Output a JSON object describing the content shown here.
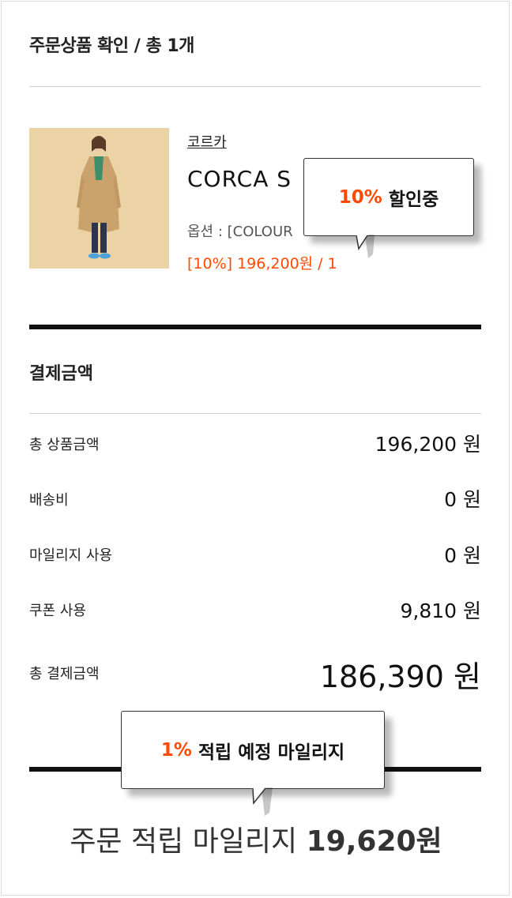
{
  "order": {
    "title": "주문상품 확인 / 총 1개"
  },
  "product": {
    "brand": "코르카",
    "name": "CORCA S",
    "option": "옵션 : [COLOUR",
    "price_line": "[10%] 196,200원 / 1",
    "discount_badge": {
      "percent": "10%",
      "text": "할인중"
    }
  },
  "payment": {
    "title": "결제금액",
    "rows": [
      {
        "label": "총 상품금액",
        "value": "196,200 원"
      },
      {
        "label": "배송비",
        "value": "0 원"
      },
      {
        "label": "마일리지 사용",
        "value": "0 원"
      },
      {
        "label": "쿠폰 사용",
        "value": "9,810 원"
      },
      {
        "label": "총 결제금액",
        "value": "186,390 원"
      }
    ]
  },
  "mileage": {
    "bubble": {
      "percent": "1%",
      "text": "적립 예정 마일리지"
    },
    "label": "주문 적립 마일리지",
    "amount": "19,620원"
  },
  "colors": {
    "accent": "#ff4a00",
    "text": "#222222",
    "rule": "#111111"
  }
}
